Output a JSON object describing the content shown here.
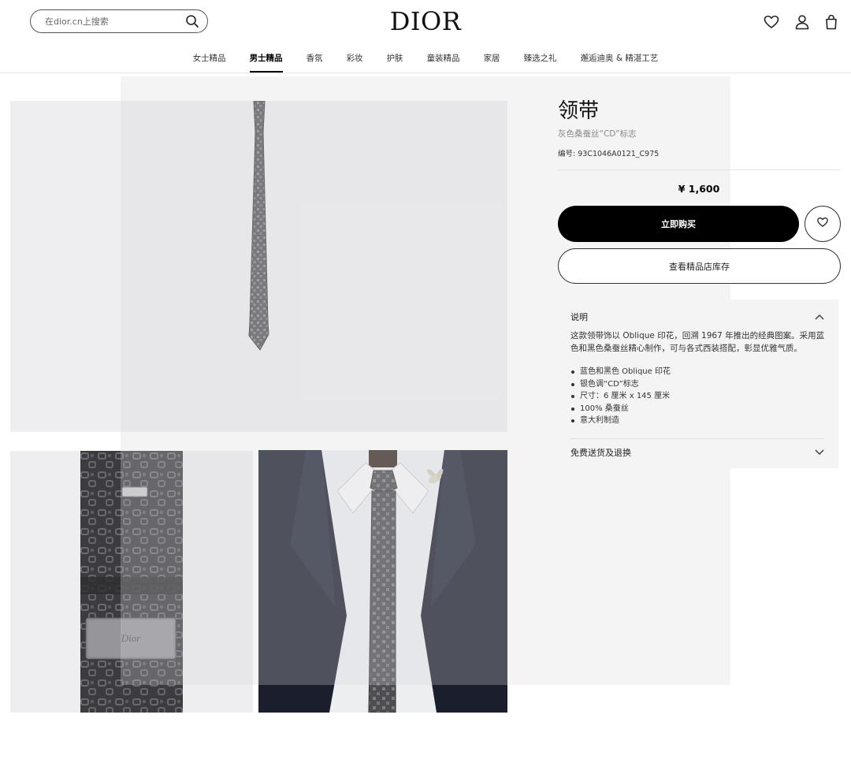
{
  "header": {
    "search_placeholder": "在dior.cn上搜索",
    "logo": "DIOR",
    "icons": [
      "heart-icon",
      "user-icon",
      "bag-icon"
    ]
  },
  "nav": {
    "items": [
      {
        "label": "女士精品",
        "active": false
      },
      {
        "label": "男士精品",
        "active": true
      },
      {
        "label": "香氛",
        "active": false
      },
      {
        "label": "彩妆",
        "active": false
      },
      {
        "label": "护肤",
        "active": false
      },
      {
        "label": "童装精品",
        "active": false
      },
      {
        "label": "家居",
        "active": false
      },
      {
        "label": "臻选之礼",
        "active": false
      },
      {
        "label": "邂逅迪奥 & 精湛工艺",
        "active": false
      }
    ]
  },
  "product": {
    "title": "领带",
    "subtitle": "灰色桑蚕丝“CD”标志",
    "sku": "编号: 93C1046A0121_C975",
    "price": "¥ 1,600",
    "buy_label": "立即购买",
    "store_label": "查看精品店库存",
    "description": {
      "heading": "说明",
      "text": "这款领带饰以 Oblique 印花，回溯 1967 年推出的经典图案。采用蓝色和黑色桑蚕丝精心制作，可与各式西装搭配，彰显优雅气质。",
      "bullets": [
        "蓝色和黑色 Oblique 印花",
        "银色调“CD”标志",
        "尺寸：6 厘米 x 145 厘米",
        "100% 桑蚕丝",
        "意大利制造"
      ]
    },
    "shipping_label": "免费送货及退换"
  },
  "gallery": {
    "images": [
      "tie-full-image",
      "tie-back-label-image",
      "tie-worn-image"
    ],
    "label_text": "Dior"
  },
  "colors": {
    "accent": "#000000",
    "panel_bg": "#f4f4f5",
    "image_bg": "#eeeef0"
  }
}
